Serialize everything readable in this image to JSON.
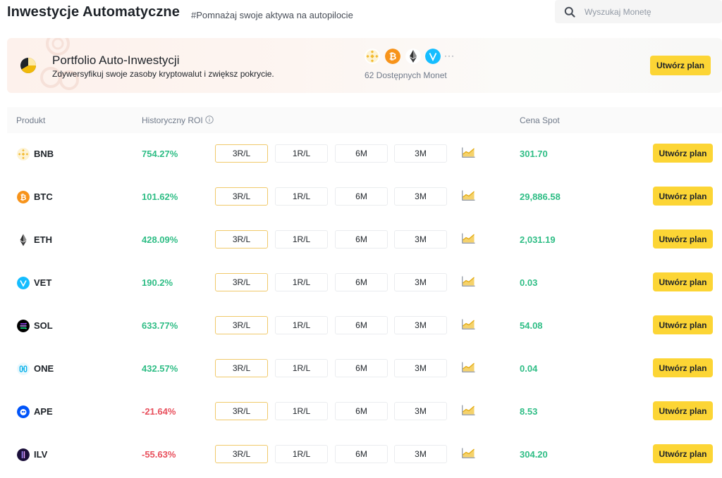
{
  "header": {
    "title": "Inwestycje Automatyczne",
    "tagline": "#Pomnażaj swoje aktywa na autopilocie",
    "search_placeholder": "Wyszukaj Monetę"
  },
  "banner": {
    "title": "Portfolio Auto-Inwestycji",
    "description": "Zdywersyfikuj swoje zasoby kryptowalut i zwiększ pokrycie.",
    "coins": [
      "bnb-icon",
      "btc-icon",
      "eth-icon",
      "vet-icon"
    ],
    "more": "···",
    "available": "62 Dostępnych Monet",
    "button": "Utwórz plan"
  },
  "table": {
    "headers": {
      "product": "Produkt",
      "roi": "Historyczny ROI",
      "price": "Cena Spot"
    },
    "periods": [
      "3R/L",
      "1R/L",
      "6M",
      "3M"
    ],
    "active_period": "3R/L",
    "row_button": "Utwórz plan",
    "rows": [
      {
        "symbol": "BNB",
        "roi": "754.27%",
        "roi_sign": "pos",
        "price": "301.70",
        "color": "#f3ba2f"
      },
      {
        "symbol": "BTC",
        "roi": "101.62%",
        "roi_sign": "pos",
        "price": "29,886.58",
        "color": "#f7931a"
      },
      {
        "symbol": "ETH",
        "roi": "428.09%",
        "roi_sign": "pos",
        "price": "2,031.19",
        "color": "#3c3c3d"
      },
      {
        "symbol": "VET",
        "roi": "190.2%",
        "roi_sign": "pos",
        "price": "0.03",
        "color": "#15bdff"
      },
      {
        "symbol": "SOL",
        "roi": "633.77%",
        "roi_sign": "pos",
        "price": "54.08",
        "color": "#000000"
      },
      {
        "symbol": "ONE",
        "roi": "432.57%",
        "roi_sign": "pos",
        "price": "0.04",
        "color": "#00aee9"
      },
      {
        "symbol": "APE",
        "roi": "-21.64%",
        "roi_sign": "neg",
        "price": "8.53",
        "color": "#0054f9"
      },
      {
        "symbol": "ILV",
        "roi": "-55.63%",
        "roi_sign": "neg",
        "price": "304.20",
        "color": "#3b1a6e"
      }
    ]
  },
  "colors": {
    "accent_yellow": "#fcd535",
    "positive": "#2ebd85",
    "negative": "#e84f5c"
  }
}
